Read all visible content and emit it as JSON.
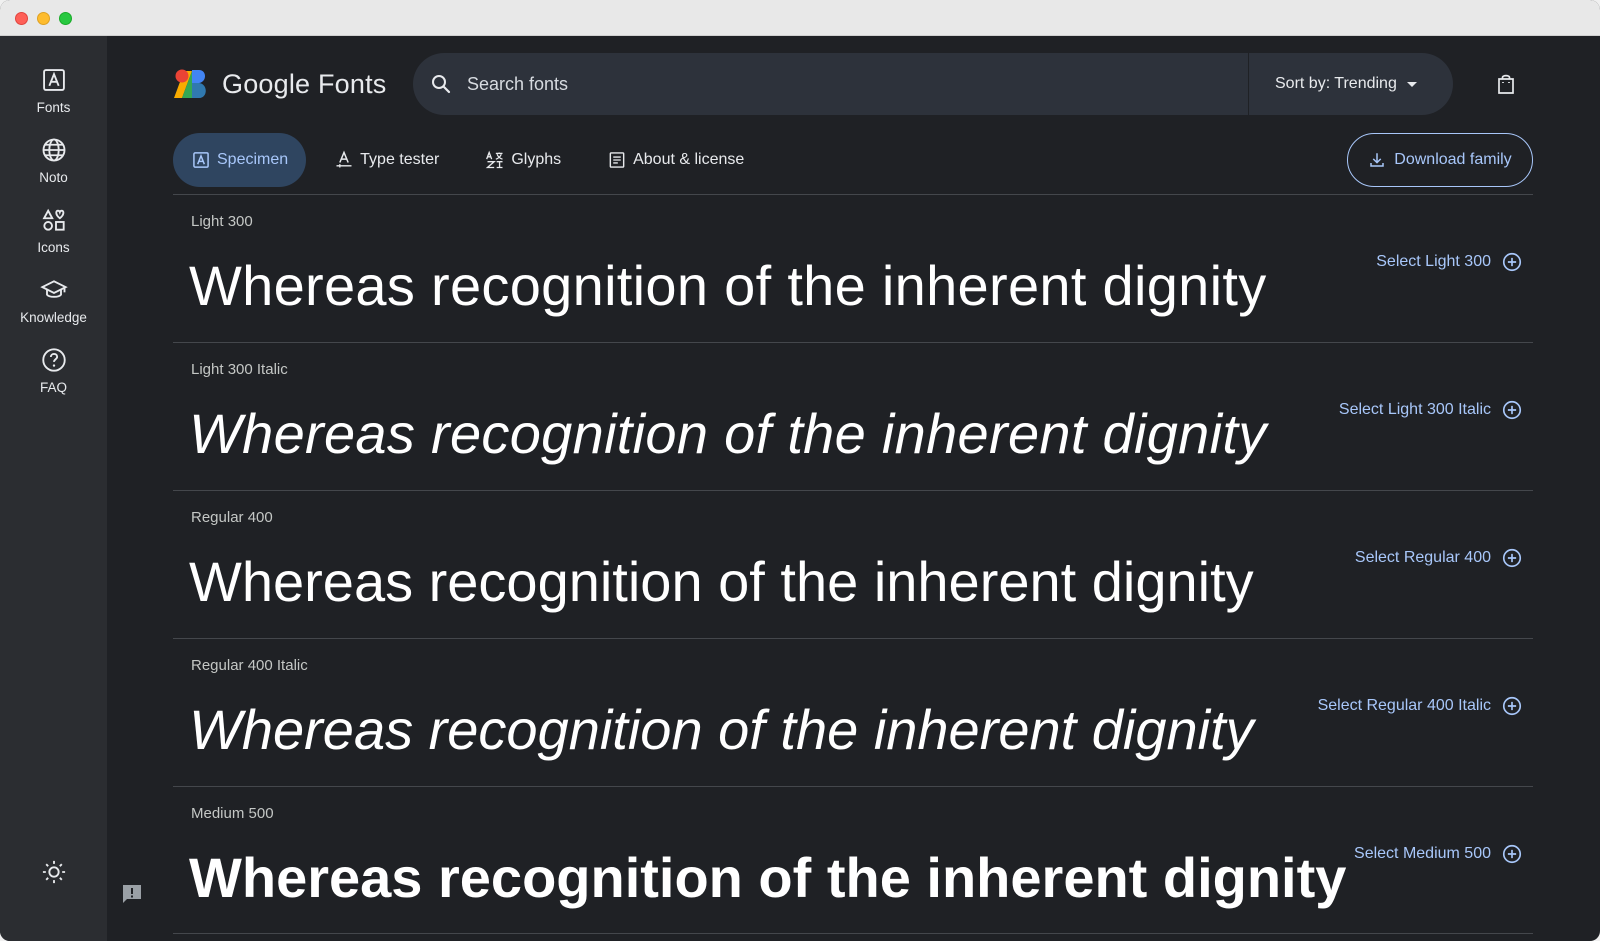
{
  "window": {
    "controls": [
      "close",
      "minimize",
      "zoom"
    ]
  },
  "rail": {
    "items": [
      {
        "label": "Fonts",
        "icon": "font-icon"
      },
      {
        "label": "Noto",
        "icon": "globe-icon"
      },
      {
        "label": "Icons",
        "icon": "shapes-icon"
      },
      {
        "label": "Knowledge",
        "icon": "school-icon"
      },
      {
        "label": "FAQ",
        "icon": "help-icon"
      }
    ],
    "theme_icon": "brightness-icon"
  },
  "header": {
    "brand": "Google Fonts",
    "search": {
      "placeholder": "Search fonts",
      "value": ""
    },
    "sort_label": "Sort by: Trending",
    "bag_icon": "shopping-bag-icon"
  },
  "tabs": [
    {
      "label": "Specimen",
      "active": true
    },
    {
      "label": "Type tester",
      "active": false
    },
    {
      "label": "Glyphs",
      "active": false
    },
    {
      "label": "About & license",
      "active": false
    }
  ],
  "download_label": "Download family",
  "styles": [
    {
      "name": "Light 300",
      "sample": "Whereas recognition of the inherent dignity",
      "select_label": "Select Light 300"
    },
    {
      "name": "Light 300 Italic",
      "sample": "Whereas recognition of the inherent dignity",
      "select_label": "Select Light 300 Italic"
    },
    {
      "name": "Regular 400",
      "sample": "Whereas recognition of the inherent dignity",
      "select_label": "Select Regular 400"
    },
    {
      "name": "Regular 400 Italic",
      "sample": "Whereas recognition of the inherent dignity",
      "select_label": "Select Regular 400 Italic"
    },
    {
      "name": "Medium 500",
      "sample": "Whereas recognition of the inherent dignity",
      "select_label": "Select Medium 500"
    }
  ],
  "colors": {
    "background": "#1f2125",
    "rail": "#2b2d31",
    "accent": "#a8c7fa",
    "active_tab": "#2f4560",
    "divider": "#44474c"
  }
}
